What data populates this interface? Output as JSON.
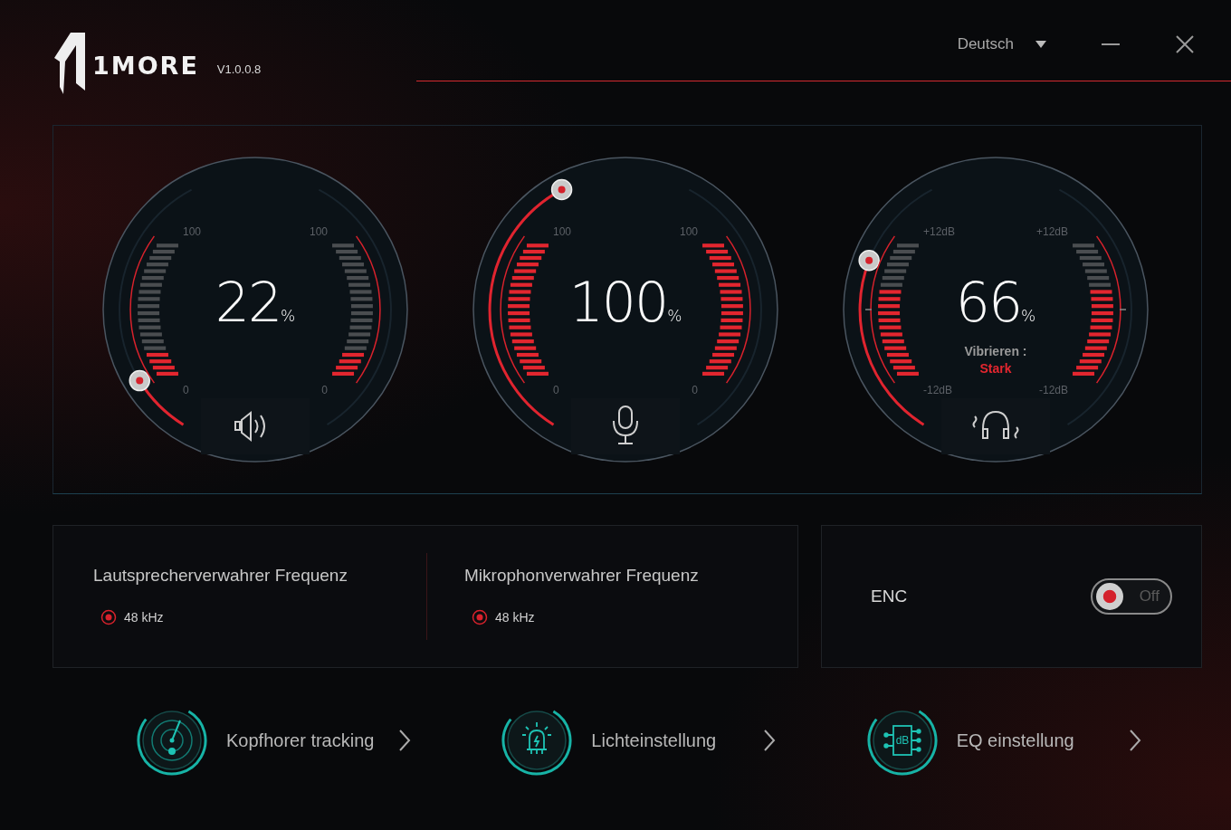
{
  "app": {
    "logo": "1MORE",
    "version": "V1.0.0.8"
  },
  "language": {
    "value": "Deutsch"
  },
  "dials": [
    {
      "kind": "volume",
      "value": "22",
      "unit": "%",
      "level": 0.22,
      "scale_left": {
        "max": "100",
        "min": "0"
      },
      "scale_right": {
        "max": "100",
        "min": "0"
      }
    },
    {
      "kind": "microphone",
      "value": "100",
      "unit": "%",
      "level": 1.0,
      "scale_left": {
        "max": "100",
        "min": "0"
      },
      "scale_right": {
        "max": "100",
        "min": "0"
      }
    },
    {
      "kind": "vibration",
      "value": "66",
      "unit": "%",
      "level": 0.66,
      "scale_left": {
        "max": "+12dB",
        "min": "-12dB"
      },
      "scale_right": {
        "max": "+12dB",
        "min": "-12dB"
      },
      "mode_label": "Vibrieren :",
      "mode_value": "Stark"
    }
  ],
  "sample_rates": [
    {
      "title": "Lautsprecherverwahrer Frequenz",
      "options": [
        {
          "label": "48 kHz",
          "selected": true
        }
      ]
    },
    {
      "title": "Mikrophonverwahrer Frequenz",
      "options": [
        {
          "label": "48 kHz",
          "selected": true
        }
      ]
    }
  ],
  "enc": {
    "label": "ENC",
    "on": false,
    "state_label": "Off"
  },
  "shortcuts": [
    {
      "kind": "tracking",
      "label": "Kopfhorer tracking"
    },
    {
      "kind": "light",
      "label": "Lichteinstellung"
    },
    {
      "kind": "eq",
      "label": "EQ einstellung",
      "icon_text": "dB"
    }
  ]
}
